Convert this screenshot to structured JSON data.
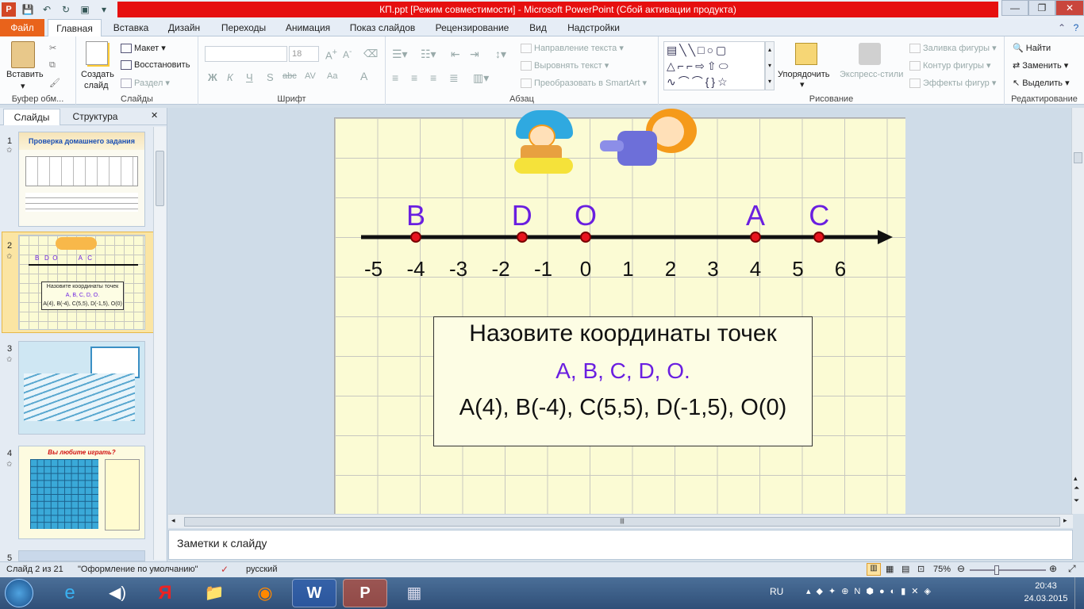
{
  "window": {
    "title": "КП.ppt [Режим совместимости]  -  Microsoft PowerPoint (Сбой активации продукта)"
  },
  "tabs": [
    "Файл",
    "Главная",
    "Вставка",
    "Дизайн",
    "Переходы",
    "Анимация",
    "Показ слайдов",
    "Рецензирование",
    "Вид",
    "Надстройки"
  ],
  "ribbon": {
    "clipboard": {
      "paste": "Вставить",
      "label": "Буфер обм..."
    },
    "slides": {
      "create": "Создать",
      "create2": "слайд",
      "layout": "Макет",
      "reset": "Восстановить",
      "section": "Раздел",
      "label": "Слайды"
    },
    "font": {
      "size": "18",
      "label": "Шрифт",
      "bold": "Ж",
      "italic": "К",
      "underline": "Ч",
      "strike": "S",
      "abc": "abc",
      "av": "AV",
      "aa": "Aa",
      "a": "A"
    },
    "paragraph": {
      "text_direction": "Направление текста",
      "align_text": "Выровнять текст",
      "smartart": "Преобразовать в SmartArt",
      "label": "Абзац"
    },
    "drawing": {
      "arrange": "Упорядочить",
      "quick_styles": "Экспресс-стили",
      "fill": "Заливка фигуры",
      "outline": "Контур фигуры",
      "effects": "Эффекты фигур",
      "label": "Рисование"
    },
    "editing": {
      "find": "Найти",
      "replace": "Заменить",
      "select": "Выделить",
      "label": "Редактирование"
    }
  },
  "panel": {
    "tab_slides": "Слайды",
    "tab_outline": "Структура",
    "close": "✕"
  },
  "thumbnails": [
    {
      "num": "1",
      "title": "Проверка домашнего задания"
    },
    {
      "num": "2",
      "labels": "B   D  O            A   C",
      "q": "Назовите координаты точек",
      "q2": "A, B, C, D, O.",
      "ans": "A(4), B(-4), C(5,5), D(-1,5), O(0)"
    },
    {
      "num": "3"
    },
    {
      "num": "4",
      "title": "Вы любите играть?"
    },
    {
      "num": "5"
    }
  ],
  "slide": {
    "points": [
      {
        "name": "B",
        "value": -4
      },
      {
        "name": "D",
        "value": -1.5
      },
      {
        "name": "O",
        "value": 0
      },
      {
        "name": "A",
        "value": 4
      },
      {
        "name": "C",
        "value": 5.5
      }
    ],
    "ticks": [
      "-5",
      "-4",
      "-3",
      "-2",
      "-1",
      "0",
      "1",
      "2",
      "3",
      "4",
      "5",
      "6"
    ],
    "question": "Назовите координаты точек",
    "question_points": "A,  B,  C,  D,  O.",
    "answer": "A(4), B(-4), C(5,5), D(-1,5), O(0)"
  },
  "notes": {
    "placeholder": "Заметки к слайду"
  },
  "status": {
    "slide": "Слайд 2 из 21",
    "theme": "\"Оформление по умолчанию\"",
    "language": "русский",
    "zoom": "75%"
  },
  "tray": {
    "lang": "RU",
    "time": "20:43",
    "date": "24.03.2015"
  }
}
